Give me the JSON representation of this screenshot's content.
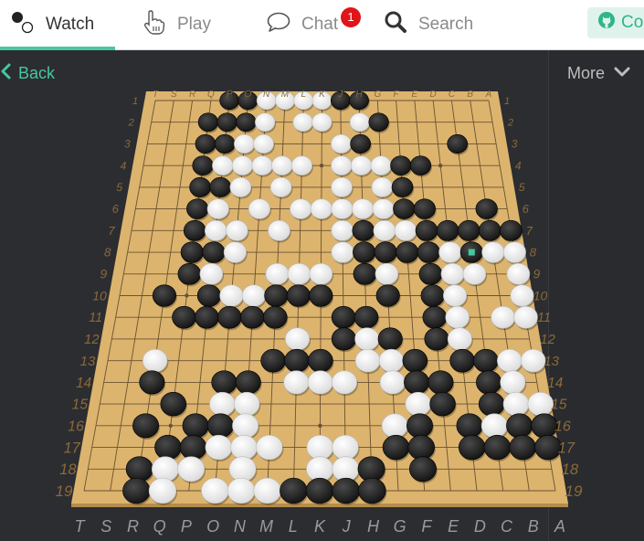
{
  "nav": {
    "tabs": [
      {
        "label": "Watch",
        "icon": "watch-stones-icon"
      },
      {
        "label": "Play",
        "icon": "pointing-hand-icon"
      },
      {
        "label": "Chat",
        "icon": "speech-bubble-icon",
        "badge": "1"
      },
      {
        "label": "Search",
        "icon": "search-icon"
      }
    ],
    "github_label": "Con"
  },
  "toolbar": {
    "back_label": "Back",
    "more_label": "More"
  },
  "colors": {
    "accent": "#46c8a0",
    "board": "#dcb46e",
    "badge": "#e0141a"
  },
  "board": {
    "size": 19,
    "col_labels": [
      "T",
      "S",
      "R",
      "Q",
      "P",
      "O",
      "N",
      "M",
      "L",
      "K",
      "J",
      "H",
      "G",
      "F",
      "E",
      "D",
      "C",
      "B",
      "A"
    ],
    "row_labels": [
      "1",
      "2",
      "3",
      "4",
      "5",
      "6",
      "7",
      "8",
      "9",
      "10",
      "11",
      "12",
      "13",
      "14",
      "15",
      "16",
      "17",
      "18",
      "19"
    ],
    "rows": [
      "....BBWWWWBB.......",
      "...BBBW.WW.WB......",
      "...BBWW...WB....B..",
      "...BWWWWW.WWWBB....",
      "...BBW.W..W.WB.....",
      "...BW.W.WWWWWBB..B.",
      "...BWW.W..WBWWBBBBB",
      "...BBW....WBBBBWBWW",
      "...BW..WWW.BW.BWW.W",
      "..B.BWWBBB..B.BW..W",
      "...BBBBB..BB..BW.WW",
      "........W.BWB.BW...",
      "..W....BBB.WWB.BBWW",
      "..B..BB.WWW.WBB.BW.",
      "...B.WW......WB.BWW",
      "..B.BBW.....WB.BWBB",
      "...BBWWW.WW.BB.BBBB",
      "..BWW.W..WWB.B.....",
      "..BW.WWWBBBB......."
    ],
    "last_move": {
      "row": 8,
      "col": 16
    }
  }
}
